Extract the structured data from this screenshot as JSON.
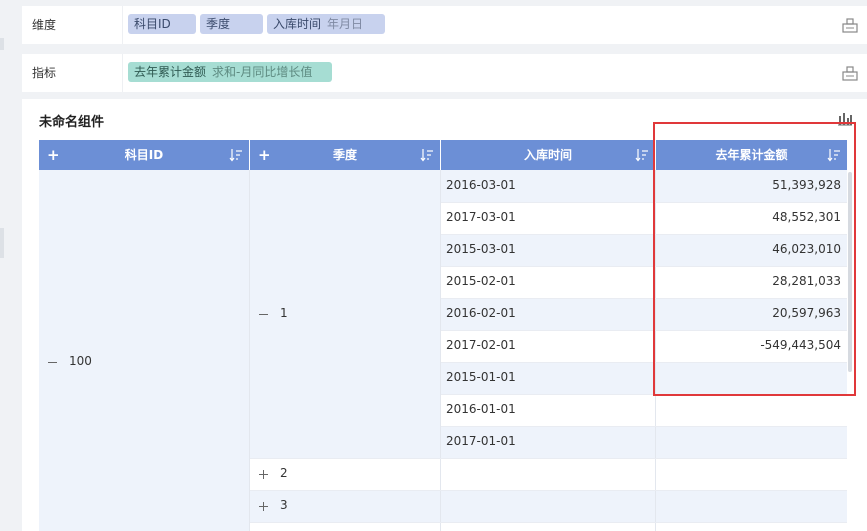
{
  "dimension_row": {
    "label": "维度",
    "chips": [
      {
        "text": "科目ID",
        "sub": ""
      },
      {
        "text": "季度",
        "sub": ""
      },
      {
        "text": "入库时间",
        "sub": "年月日"
      }
    ]
  },
  "metric_row": {
    "label": "指标",
    "chips": [
      {
        "text": "去年累计金额",
        "sub": "求和-月同比增长值"
      }
    ]
  },
  "widget": {
    "title": "未命名组件",
    "headers": {
      "col1": "科目ID",
      "col2": "季度",
      "col3": "入库时间",
      "col4": "去年累计金额"
    },
    "plus_glyph": "+",
    "subject_id": "100",
    "quarter_expanded": "1",
    "quarters_collapsed": [
      "2",
      "3"
    ],
    "rows": [
      {
        "date": "2016-03-01",
        "value": "51,393,928"
      },
      {
        "date": "2017-03-01",
        "value": "48,552,301"
      },
      {
        "date": "2015-03-01",
        "value": "46,023,010"
      },
      {
        "date": "2015-02-01",
        "value": "28,281,033"
      },
      {
        "date": "2016-02-01",
        "value": "20,597,963"
      },
      {
        "date": "2017-02-01",
        "value": "-549,443,504"
      },
      {
        "date": "2015-01-01",
        "value": ""
      },
      {
        "date": "2016-01-01",
        "value": ""
      },
      {
        "date": "2017-01-01",
        "value": ""
      }
    ]
  },
  "colors": {
    "header_blue": "#6c8fd6",
    "dimension_chip": "#c8d2ee",
    "metric_chip": "#a6ddd3",
    "row_stripe": "#eef3fb",
    "highlight_red": "#e0383a"
  },
  "icons": {
    "field_action": "widget-settings-icon",
    "chart_type": "bar-chart-icon",
    "sort": "sort-descending-icon"
  }
}
